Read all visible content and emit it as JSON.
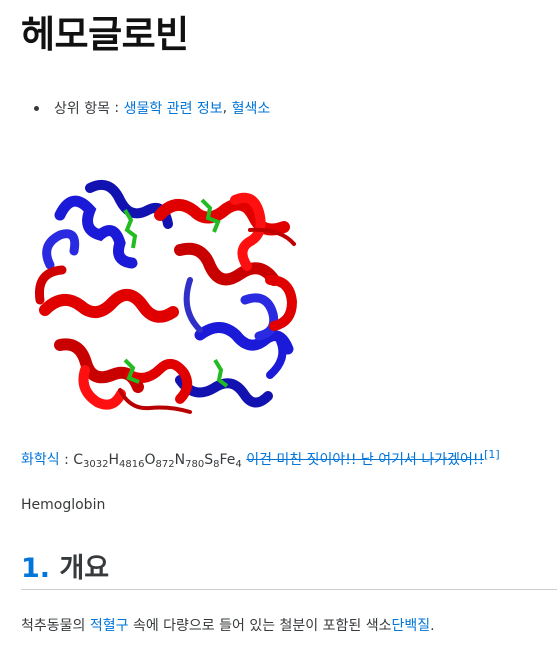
{
  "page": {
    "title": "헤모글로빈"
  },
  "parent_docs": {
    "label": "상위 항목",
    "separator": " : ",
    "links": [
      {
        "text": "생물학 관련 정보"
      },
      {
        "text": "혈색소"
      }
    ],
    "joiner": ", "
  },
  "formula": {
    "label": "화학식",
    "separator": " : ",
    "elements": [
      {
        "symbol": "C",
        "count": "3032"
      },
      {
        "symbol": "H",
        "count": "4816"
      },
      {
        "symbol": "O",
        "count": "872"
      },
      {
        "symbol": "N",
        "count": "780"
      },
      {
        "symbol": "S",
        "count": "8"
      },
      {
        "symbol": "Fe",
        "count": "4"
      }
    ],
    "strike_note": "이건 미친 짓이야!! 난 여기서 나가겠어!!",
    "footnote": "[1]"
  },
  "english_name": "Hemoglobin",
  "section": {
    "number": "1.",
    "title": "개요"
  },
  "summary": {
    "part1": "척추동물의 ",
    "link1": "적혈구",
    "part2": " 속에 다량으로 들어 있는 철분이 포함된 색소",
    "link2": "단백질",
    "part3": "."
  },
  "colors": {
    "link": "#0275d8",
    "text": "#373a3c",
    "helix_red": "#e00000",
    "helix_blue": "#1a1ad8",
    "heme_green": "#22bb22"
  }
}
